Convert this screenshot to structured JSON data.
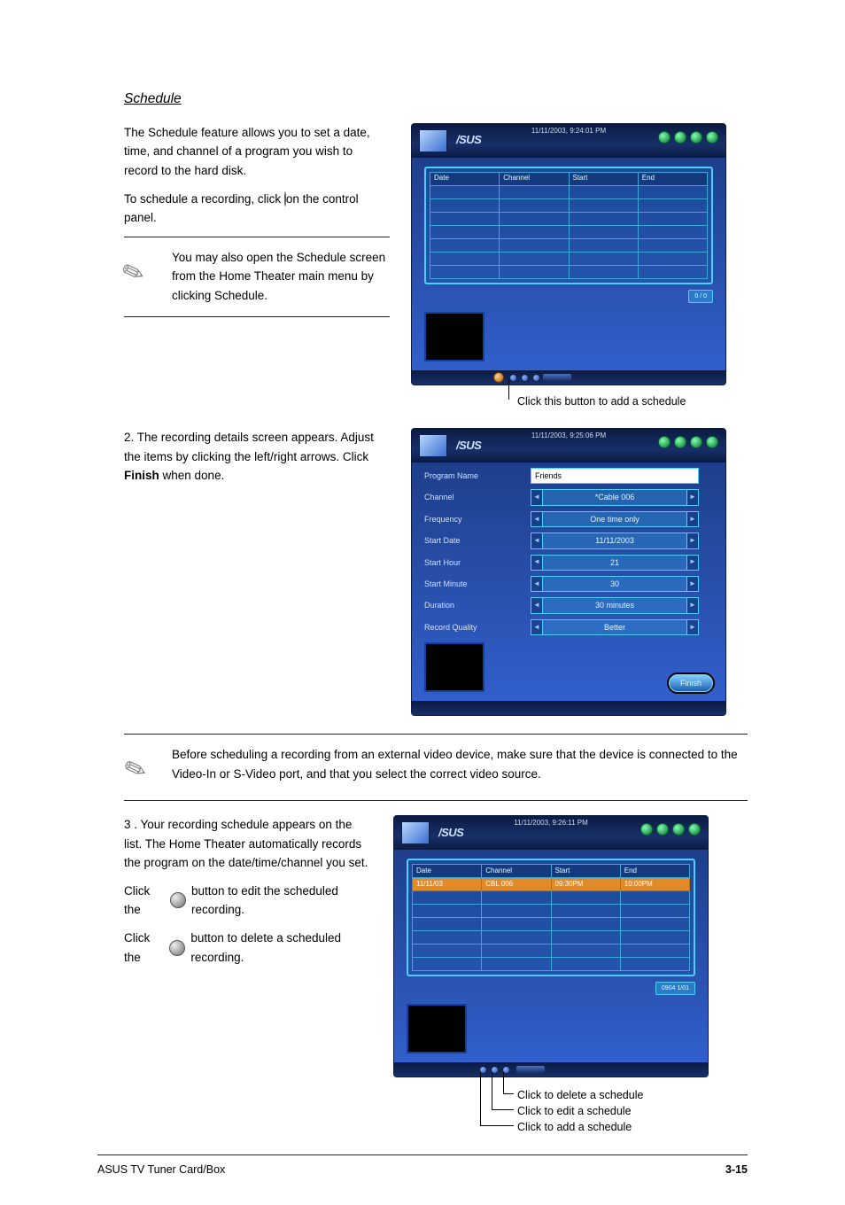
{
  "heading": "Schedule",
  "intro": {
    "p1a": "The Schedule feature allows you to set a date, time, and channel of a program you wish to record to the hard disk.",
    "p2a": "To schedule a recording, click",
    "p2b": "on the control panel.",
    "controlPanelIcon": "control-panel-record-icon"
  },
  "note1": "You may also open the Schedule screen from the Home Theater main menu by clicking Schedule.",
  "shot1": {
    "datetime": "11/11/2003, 9:24:01 PM",
    "cols": [
      "Date",
      "Channel",
      "Start",
      "End"
    ],
    "pager": "0 / 0",
    "callout": "Click this button to add a schedule"
  },
  "step2": {
    "p": "2. The recording details screen appears. Adjust the items by clicking the left/right arrows. Click",
    "finishWord": "Finish",
    "p2": "when done."
  },
  "shot2": {
    "datetime": "11/11/2003, 9:25:06 PM",
    "fields": [
      {
        "label": "Program Name",
        "type": "text",
        "value": "Friends"
      },
      {
        "label": "Channel",
        "type": "sel",
        "value": "*Cable 006"
      },
      {
        "label": "Frequency",
        "type": "sel",
        "value": "One time only"
      },
      {
        "label": "Start Date",
        "type": "sel",
        "value": "11/11/2003"
      },
      {
        "label": "Start Hour",
        "type": "sel",
        "value": "21"
      },
      {
        "label": "Start Minute",
        "type": "sel",
        "value": "30"
      },
      {
        "label": "Duration",
        "type": "sel",
        "value": "30 minutes"
      },
      {
        "label": "Record Quality",
        "type": "sel",
        "value": "Better"
      }
    ],
    "finish": "Finish"
  },
  "note2": "Before scheduling a recording from an external video device, make sure that the device is connected to the Video-In or S-Video port, and that you select the correct video source.",
  "step3": {
    "p": "3 . Your recording schedule appears on the list. The Home Theater automatically records the program on the date/time/channel you set.",
    "p2a": "Click the",
    "p2b": "button to edit the scheduled recording.",
    "p3a": "Click the",
    "p3b": "button to delete a scheduled recording."
  },
  "shot3": {
    "datetime": "11/11/2003, 9:26:11 PM",
    "cols": [
      "Date",
      "Channel",
      "Start",
      "End"
    ],
    "row": [
      "11/11/03",
      "CBL 006",
      "09:30PM",
      "10:00PM"
    ],
    "pager": "0904   1/01",
    "callouts": {
      "c1": "Click to delete a schedule",
      "c2": "Click to edit a schedule",
      "c3": "Click to add a schedule"
    }
  },
  "footer": {
    "left": "ASUS TV Tuner Card/Box",
    "right": "3-15"
  }
}
